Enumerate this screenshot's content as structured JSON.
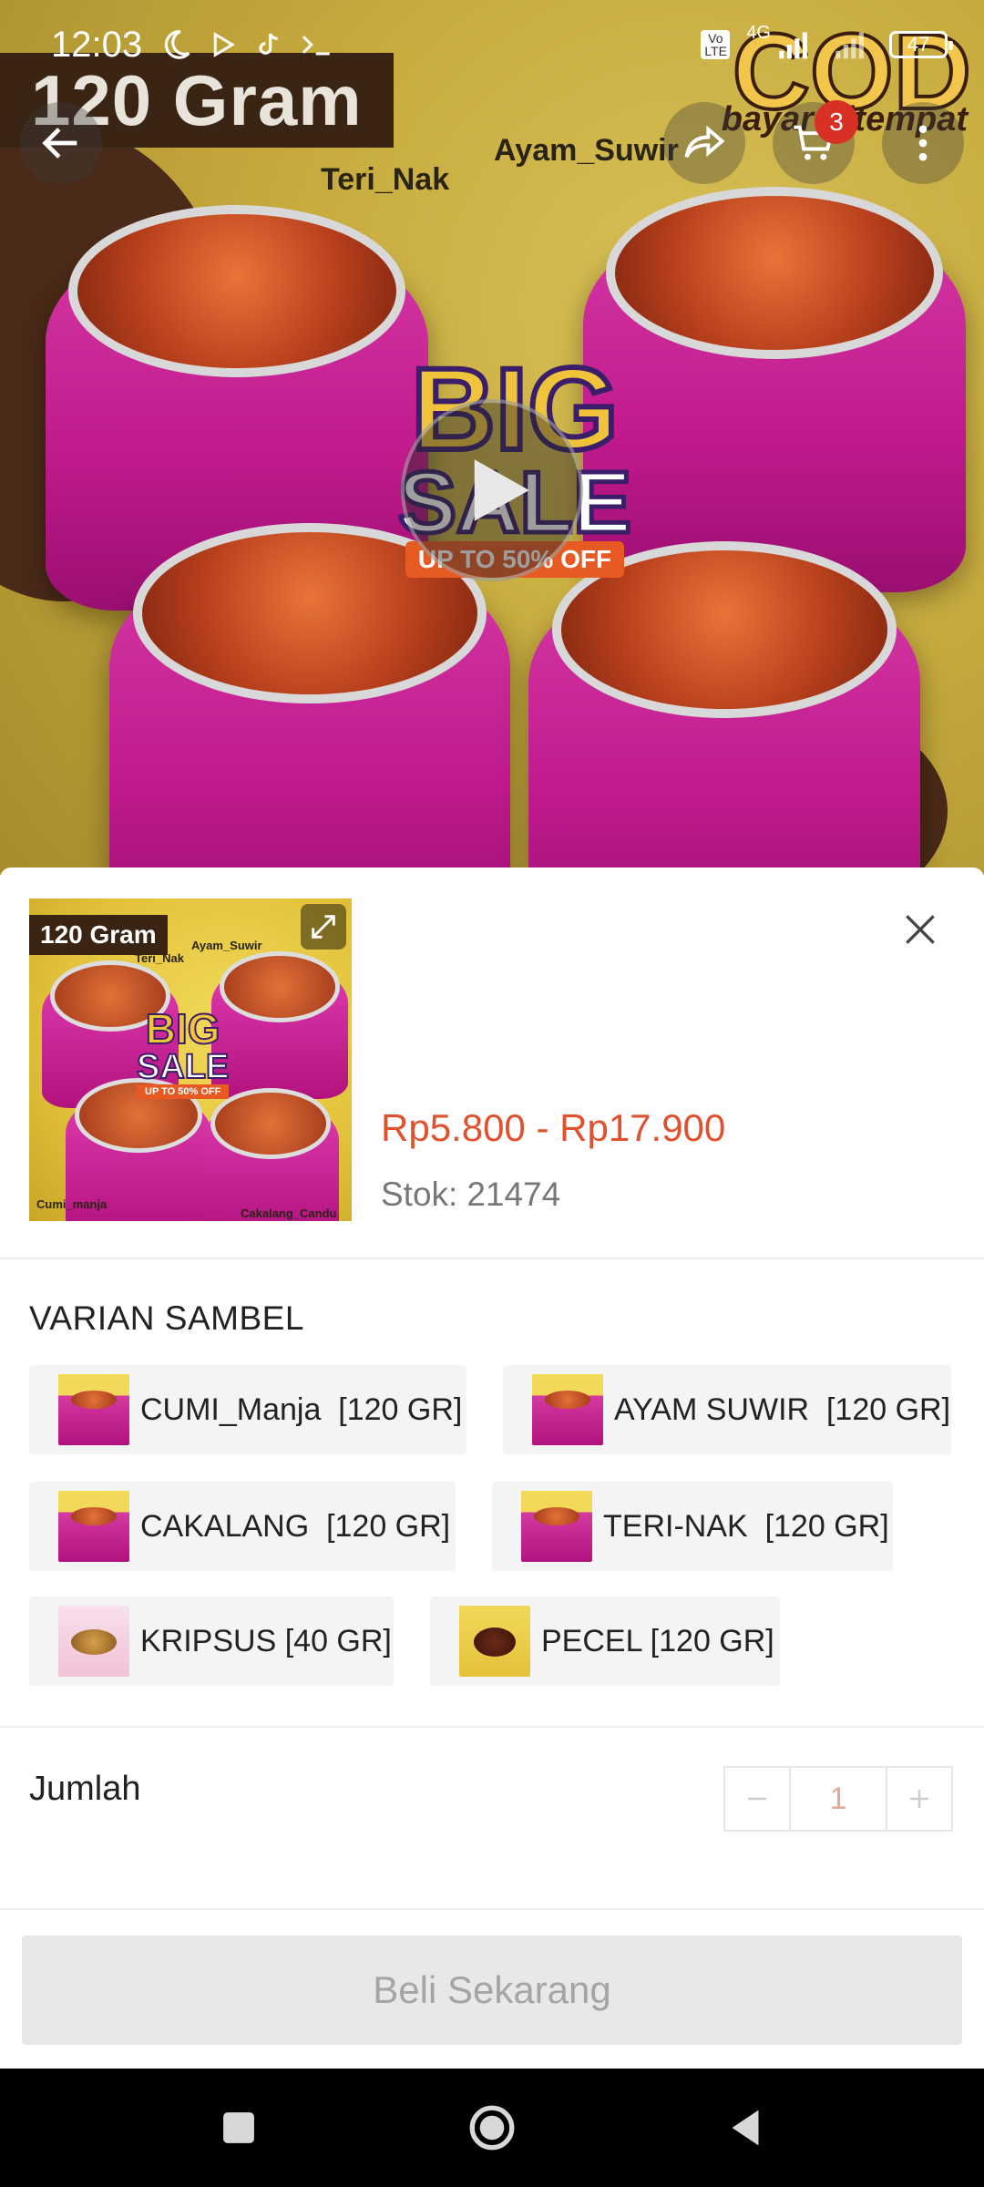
{
  "status_bar": {
    "time": "12:03",
    "battery": "47",
    "network": "4G",
    "volte": "Vo LTE"
  },
  "hero": {
    "banner_label": "120 Gram",
    "annotation_1": "Teri_Nak",
    "annotation_2": "Ayam_Suwir",
    "big": "BIG",
    "sale": "SALE",
    "upto": "UP TO 50% OFF",
    "cod": "COD",
    "cod_sub": "bayar ditempat",
    "cart_count": "3"
  },
  "product": {
    "thumb": {
      "label": "120 Gram",
      "big": "BIG",
      "sale": "SALE",
      "upto": "UP TO 50% OFF",
      "tag_teri": "Teri_Nak",
      "tag_ayam": "Ayam_Suwir",
      "tag_cumi": "Cumi_manja",
      "tag_cakalang": "Cakalang_Candu"
    },
    "price": "Rp5.800 - Rp17.900",
    "stock_label": "Stok:",
    "stock_value": "21474"
  },
  "variants": {
    "title": "VARIAN SAMBEL",
    "items": [
      {
        "label": "CUMI_Manja  [120 GR]",
        "icon": "sambel-cup-thumb"
      },
      {
        "label": "AYAM SUWIR  [120 GR]",
        "icon": "sambel-cup-thumb"
      },
      {
        "label": "CAKALANG  [120 GR]",
        "icon": "sambel-cup-thumb"
      },
      {
        "label": "TERI-NAK  [120 GR]",
        "icon": "sambel-cup-thumb"
      },
      {
        "label": "KRIPSUS [40 GR]",
        "icon": "kripsus-pack-thumb"
      },
      {
        "label": "PECEL [120 GR]",
        "icon": "pecel-bowl-thumb"
      }
    ]
  },
  "quantity": {
    "label": "Jumlah",
    "value": "1"
  },
  "buy_button": "Beli Sekarang",
  "colors": {
    "price": "#e0512d",
    "cart_badge": "#d93025",
    "disabled_button_bg": "#e8e8e8",
    "disabled_button_text": "#a5a5a5"
  }
}
